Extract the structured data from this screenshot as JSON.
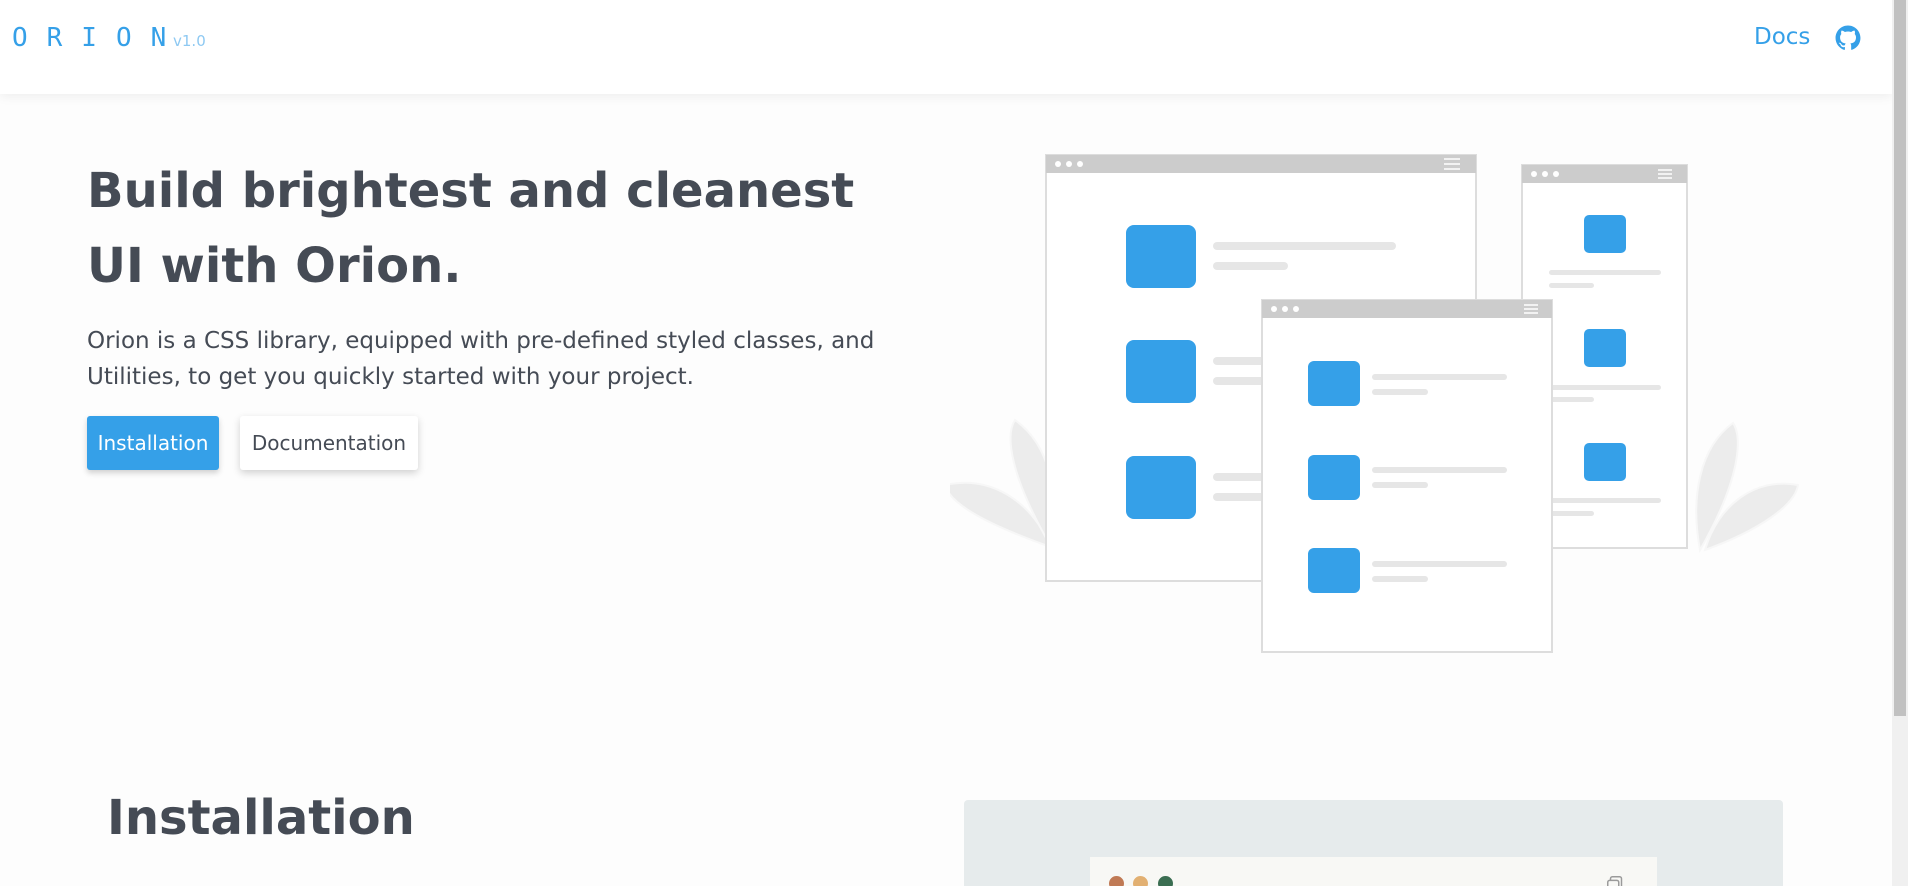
{
  "nav": {
    "logo": "ORION",
    "version": "v1.0",
    "docs_label": "Docs",
    "github_icon": "github-icon"
  },
  "hero": {
    "title": "Build brightest and cleanest UI with Orion.",
    "subtitle": "Orion is a CSS library, equipped with pre-defined styled classes, and Utilities, to get you quickly started with your project.",
    "primary_button": "Installation",
    "secondary_button": "Documentation"
  },
  "installation": {
    "title": "Installation"
  },
  "colors": {
    "accent": "#35a0e8",
    "text": "#454b55",
    "dot_red": "#c07a55",
    "dot_yellow": "#e2b072",
    "dot_green": "#3b6e52"
  }
}
